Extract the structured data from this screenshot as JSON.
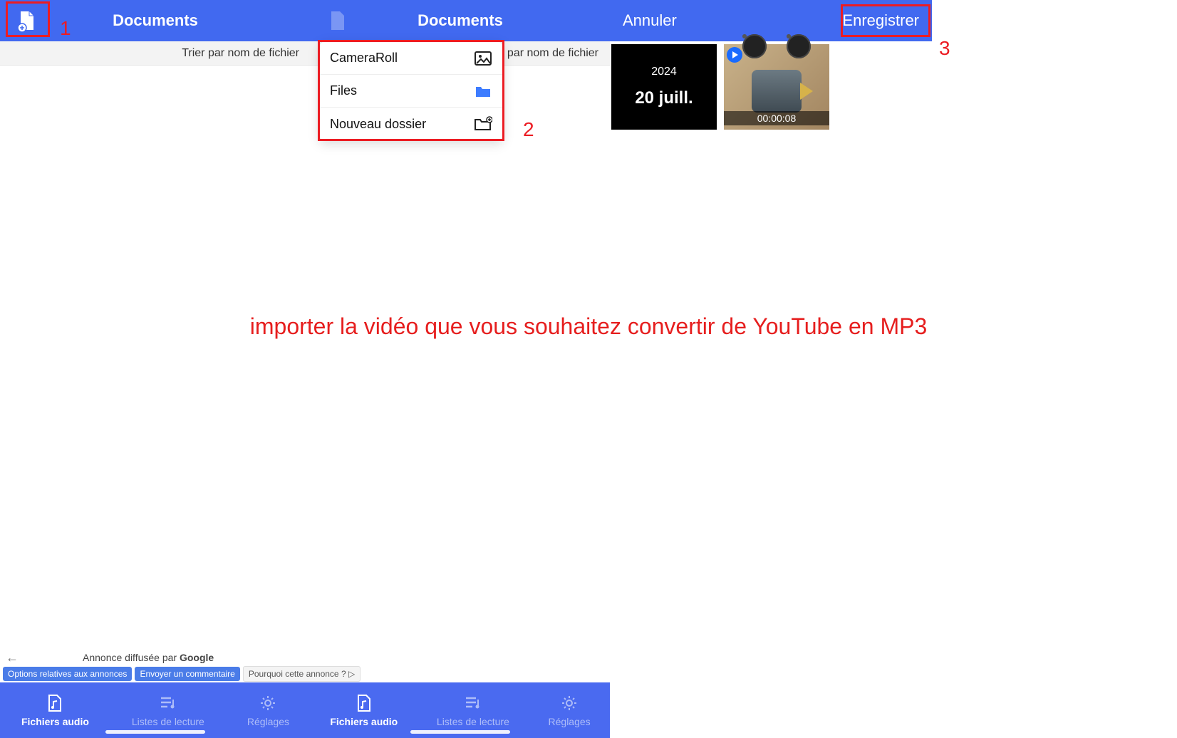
{
  "panel1": {
    "title": "Documents",
    "sort_label": "Trier par nom de fichier",
    "highlight_label": "1"
  },
  "panel2": {
    "title": "Documents",
    "sort_label_partial": "ier par nom de fichier",
    "menu": {
      "item0": "CameraRoll",
      "item1": "Files",
      "item2": "Nouveau dossier"
    },
    "highlight_label": "2"
  },
  "panel3": {
    "cancel": "Annuler",
    "save": "Enregistrer",
    "thumb_year": "2024",
    "thumb_date": "20 juill.",
    "thumb_duration": "00:00:08",
    "highlight_label": "3"
  },
  "caption": "importer la vidéo que vous souhaitez convertir de YouTube en MP3",
  "ads": {
    "top_text_prefix": "Annonce diffusée par ",
    "brand": "Google",
    "pill0": "Options relatives aux annonces",
    "pill1": "Envoyer un commentaire",
    "pill2": "Pourquoi cette annonce ? ▷"
  },
  "tabs": {
    "t0": "Fichiers audio",
    "t1": "Listes de lecture",
    "t2": "Réglages"
  }
}
